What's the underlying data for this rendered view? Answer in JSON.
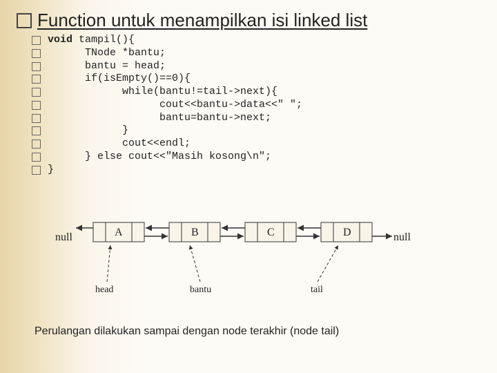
{
  "title": "Function untuk menampilkan isi linked list",
  "code": {
    "lines": [
      "void tampil(){",
      "      TNode *bantu;",
      "      bantu = head;",
      "      if(isEmpty()==0){",
      "            while(bantu!=tail->next){",
      "                  cout<<bantu->data<<\" \";",
      "                  bantu=bantu->next;",
      "            }",
      "            cout<<endl;",
      "      } else cout<<\"Masih kosong\\n\";",
      "}"
    ],
    "keyword": "void"
  },
  "diagram": {
    "null_left": "null",
    "null_right": "null",
    "nodes": [
      "A",
      "B",
      "C",
      "D"
    ],
    "labels": {
      "head": "head",
      "bantu": "bantu",
      "tail": "tail"
    }
  },
  "caption": "Perulangan dilakukan sampai dengan node terakhir (node tail)"
}
